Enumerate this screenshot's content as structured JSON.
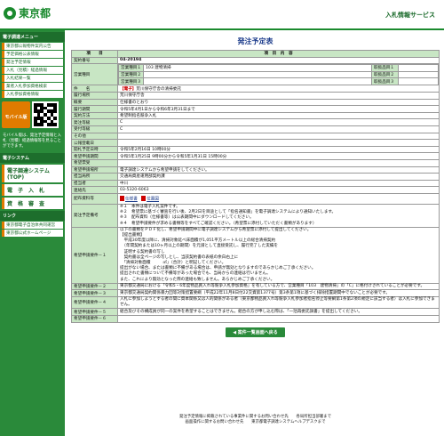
{
  "header": {
    "logo_text": "東京都",
    "service_name": "入札情報サービス"
  },
  "sidebar": {
    "menu_heading": "電子調達メニュー",
    "links": [
      "東京都公報物件案内公告",
      "予定価格公表情報",
      "発注予定情報",
      "入札（見積）経過情報",
      "入札結果一覧",
      "業者入札参加資格検索",
      "入札参加資格情報"
    ],
    "mobile_label": "モバイル版",
    "mobile_note": "モバイル版は、発注予定情報と入札（見積）経過情報等を見ることができます。",
    "system_heading": "電子システム",
    "big_links": [
      "電子調達システム(TOP)",
      "電　子　入　札",
      "資　格　審　査"
    ],
    "link_heading": "リンク",
    "sub_links": [
      "東京都電子自治体共同運営",
      "東京都公式ホームページ"
    ]
  },
  "page": {
    "title": "発注予定表",
    "col_item": "項　　目",
    "col_content": "項　目　内　容"
  },
  "details": {
    "contract_no_label": "契約番号",
    "contract_no": "04-20194",
    "category_label": "営業種目",
    "categories": [
      {
        "code": "営業種目１",
        "value": "103 建物清掃",
        "rank": "取扱品目１"
      },
      {
        "code": "営業種目２",
        "value": "",
        "rank": "取扱品目２"
      },
      {
        "code": "営業種目３",
        "value": "",
        "rank": "取扱品目３"
      }
    ],
    "subject_label": "件　　名",
    "subject_tag": "【電子】",
    "subject": "荒川保守庁舎の清掃委託",
    "location_label": "履行場所",
    "location": "荒川保守庁舎",
    "summary_label": "概要",
    "summary": "仕様書のとおり",
    "period_label": "履行期間",
    "period": "令和5年4月1日から令和6年3月31日まで",
    "method_label": "契約方法",
    "method": "希望制指名競争入札",
    "order_grade_label": "発注等級",
    "order_grade": "C",
    "accept_grade_label": "受付等級",
    "accept_grade": "C",
    "other_label": "その他",
    "other": "",
    "announce_label": "公報登載日",
    "announce": "",
    "open_label": "開札予定日時",
    "open": "令和5年2月16日 10時00分",
    "apply_label": "希望申請期間",
    "apply": "令和5年1月25日 9時00分から令和5年1月31日 15時00分",
    "apply_place_label": "希望票受",
    "apply_place": "",
    "apply_way_label": "希望申請場所",
    "apply_way": "電子調達システムから希望申請をしてください。",
    "dept_label": "担当局所",
    "dept": "交通局資産運用部契約課",
    "person_label": "担当者",
    "person": "中川",
    "tel_label": "連絡先",
    "tel": "03-5320-6063",
    "doc_label": "配布資料等",
    "doc_links": [
      "仕様書",
      "位置図"
    ],
    "notes_label": "発注予定備考",
    "notes": [
      "※１　本件は電子入札案件です。",
      "※２　希望票に基づく審査を行い後、2月2日を目途として「指名通知書」を電子調達システムにより通知いたします。",
      "※３　配布資料（仕様書等）は公表期間中にダウンロードしてください。",
      "※４　希望申請要件が求める書類等をすべてご確認ください。（希望票に添付していただく書類があります）"
    ],
    "req1_label": "希望申請要件－１",
    "req1": [
      "以下の書類をＰＤＦ化し、希望申請期間中に電子調達システムから希望票に添付して提出してください。",
      "【提出書類】",
      "　平成30年度以降に、清掃対象延べ床面積が1,051平方メートル以上の総合清掃契約",
      "　（年間契約または10ヶ月以上の期間）を元請として直接受託し、履行完了した実績を",
      "　証明する契約書の写し",
      "　契約書は全ページの写しとし、当該契約書の表紙の余白右上に",
      "　「清掃対象面積　　　㎡」（合計）と明記してください。",
      "提出がない場合、または書類に不備がある場合は、申請が無効となりますのであらかじめご了承ください。",
      "提出された書類について不備等があった場合でも、当局からの連絡は行いません。",
      "また、これにより無効となった際の連絡も致しません。あらかじめご了承ください。"
    ],
    "req2_label": "希望申請要件－２",
    "req2": "東京都交通局における「令和5・6年度物品買入れ等競争入札参加資格」を有している方で、営業種目「103　建物清掃」の「C」に格付けされていることが必要です。",
    "req3_label": "希望申請要件－３",
    "req3": "東京都交通局契約関係暴力団等対策措置要綱（平成22年11月8日付22交資第1377号）第3条第1項に基づく排除措置期間中でないことが必要です。",
    "req4_label": "希望申請要件－４",
    "req4": "入札に参加しようとする者の間に資本関係又は人的関係がある者（東京都物品買入れ等競争入札参加者指名停止等要綱第1条第2項の規定に該当する者）は入札に参加できません。",
    "req5_label": "希望申請要件－５",
    "req5": "組合及びその構成員が同一の案件を希望することはできません。組合の方が申し込む際は、「一括再委託調書」を提出してください。",
    "req6_label": "希望申請要件－６",
    "req6": ""
  },
  "back_button": "◀ 案件一覧画面へ戻る",
  "footer": {
    "line1": "発注予定情報に掲載されている事業件に関するお問い合わせ先　　各局所担当部署まで",
    "line2": "画面操作に関するお問い合わせ先　　東京都電子調達システムヘルプデスクまで"
  }
}
